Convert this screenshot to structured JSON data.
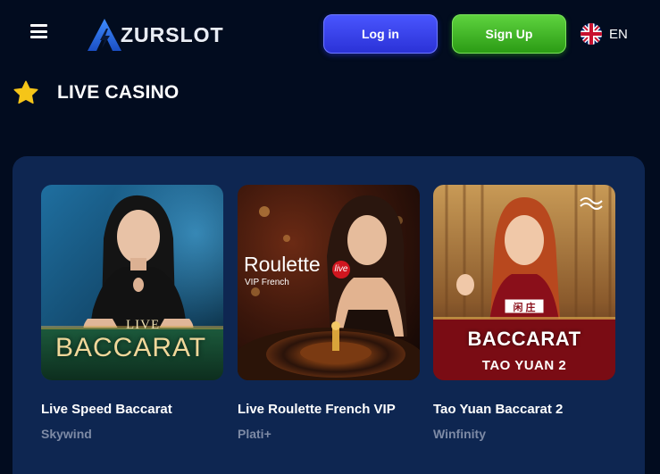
{
  "header": {
    "logo_text": "ZURSLOT",
    "login_label": "Log in",
    "signup_label": "Sign Up",
    "language_code": "EN"
  },
  "section": {
    "title": "LIVE CASINO"
  },
  "games": [
    {
      "title": "Live Speed Baccarat",
      "provider": "Skywind",
      "thumb_line1": "LIVE",
      "thumb_line2": "BACCARAT"
    },
    {
      "title": "Live Roulette French VIP",
      "provider": "Plati+",
      "thumb_line1": "Roulette",
      "thumb_badge": "live",
      "thumb_line2": "VIP French"
    },
    {
      "title": "Tao Yuan Baccarat 2",
      "provider": "Winfinity",
      "thumb_line1": "BACCARAT",
      "thumb_line2": "TAO YUAN 2",
      "thumb_tag": "闲 庄"
    }
  ],
  "colors": {
    "background": "#020c1f",
    "panel": "#0e2651",
    "login_button": "#3540f0",
    "signup_button": "#41b825",
    "star": "#f5c518",
    "provider_text": "#7d8aa5"
  },
  "icons": {
    "menu": "hamburger-icon",
    "logo": "logo-a-bolt-icon",
    "flag": "uk-flag-icon",
    "section": "star-icon"
  }
}
